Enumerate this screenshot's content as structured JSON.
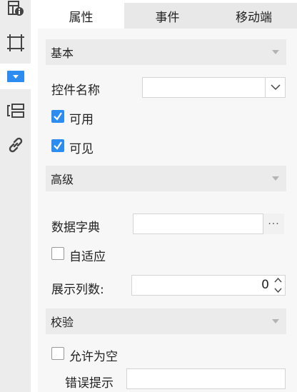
{
  "rail": {
    "icons": [
      "info-grid-icon",
      "frame-icon",
      "dropdown-widget-icon",
      "layout-stack-icon",
      "link-icon"
    ],
    "active_index": 2
  },
  "tabs": [
    {
      "label": "属性",
      "active": true
    },
    {
      "label": "事件",
      "active": false
    },
    {
      "label": "移动端",
      "active": false
    }
  ],
  "sections": {
    "basic": "基本",
    "advanced": "高级",
    "validation": "校验"
  },
  "basic": {
    "widget_name_label": "控件名称",
    "widget_name_value": "",
    "enabled_label": "可用",
    "enabled_checked": true,
    "visible_label": "可见",
    "visible_checked": true
  },
  "advanced": {
    "dictionary_label": "数据字典",
    "dictionary_value": "",
    "dictionary_button": "···",
    "autofit_label": "自适应",
    "autofit_checked": false,
    "columns_label": "展示列数:",
    "columns_value": "0"
  },
  "validation": {
    "allow_empty_label": "允许为空",
    "allow_empty_checked": false,
    "error_hint_label": "错误提示",
    "error_hint_value": ""
  },
  "colors": {
    "accent": "#2d8cf0",
    "rail_bg": "#ececec",
    "panel_bg": "#f7f7f7",
    "section_bg": "#ebebeb"
  }
}
